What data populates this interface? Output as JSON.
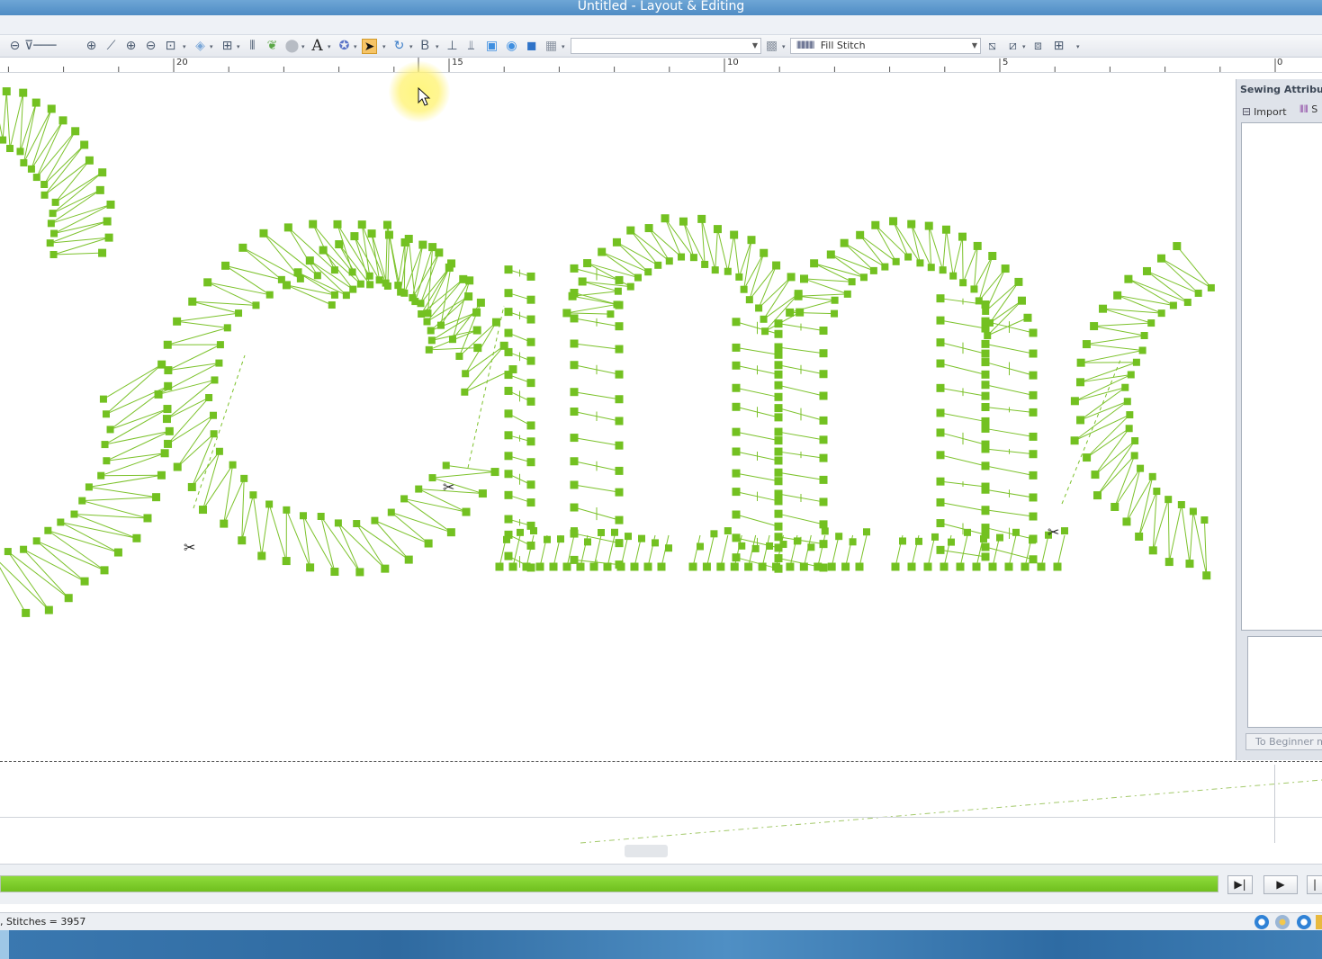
{
  "window": {
    "title": "Untitled - Layout & Editing"
  },
  "toolbar": {
    "icons": [
      "zoom-out-icon",
      "zoom-slider-icon",
      "add-icon",
      "measure-icon",
      "zoom-in-icon",
      "zoom-out-small-icon",
      "zoom-fit-icon",
      "select-area-icon",
      "align-icon",
      "line-tool-icon",
      "shape-tool-icon",
      "text-tool-icon",
      "stamp-tool-icon",
      "select-arrow-icon",
      "rotate-icon",
      "bitmap-icon",
      "thread-icon",
      "split-icon",
      "color-tool-icon",
      "fill-tool-icon",
      "applique-icon",
      "region-icon"
    ],
    "line_sew_combo": "",
    "region_sew_type": "Fill Stitch",
    "accent_color": "#4f8cc4"
  },
  "ruler": {
    "labels": [
      "20",
      "15",
      "10",
      "5",
      "0"
    ]
  },
  "panel": {
    "title": "Sewing Attributes",
    "import_label": "Import",
    "second_tab_fragment": "S",
    "beginner_button": "To Beginner mo"
  },
  "design": {
    "stitch_color": "#73c121",
    "letters_visible": [
      "e",
      "n",
      "n"
    ]
  },
  "playback": {
    "progress_percent": 100,
    "end_button": "skip-to-end-icon",
    "play_button": "play-icon"
  },
  "status": {
    "text": ", Stitches = 3957"
  }
}
